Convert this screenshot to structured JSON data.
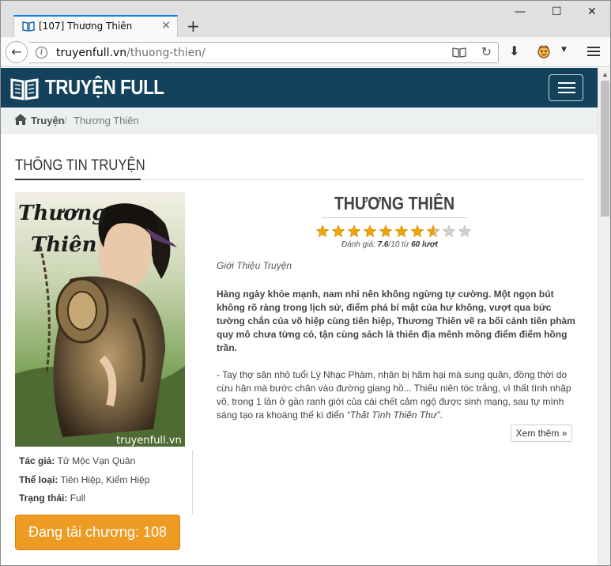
{
  "browser": {
    "tab_title": "[107] Thương Thiên",
    "tab_close": "×",
    "new_tab": "+",
    "window_controls": {
      "minimize": "—",
      "maximize": "☐",
      "close": "✕"
    },
    "url_host": "truyenfull.vn",
    "url_path": "/thuong-thien/",
    "icons": [
      "back-icon",
      "info-icon",
      "reader-view-icon",
      "reload-icon",
      "download-icon",
      "extension-icon",
      "overflow-menu-icon"
    ]
  },
  "site": {
    "logo_text": "TRUYỆN FULL",
    "brand_color": "#14425d",
    "breadcrumb": [
      "Truyện",
      "Thương Thiên"
    ],
    "breadcrumb_sep": "/"
  },
  "section_title": "Thông tin truyện",
  "cover": {
    "title_line1": "Thương",
    "title_line2": "Thiên",
    "watermark": "truyenfull.vn"
  },
  "info": {
    "author_label": "Tác giả:",
    "author": "Tử Mộc Vạn Quân",
    "genre_label": "Thể loại:",
    "genre": "Tiên Hiệp, Kiếm Hiệp",
    "status_label": "Trạng thái:",
    "status": "Full"
  },
  "loading_button": "Đang tải chương: 108",
  "story": {
    "title": "THƯƠNG THIÊN",
    "rating": 7.6,
    "rating_max": 10,
    "stars_total": 10,
    "rating_label": "Đánh giá:",
    "rating_value": "7.6",
    "rating_mid": "/10 từ ",
    "rating_count": "60 lượt",
    "intro_label": "Giới Thiệu Truyện",
    "desc_bold": "Hàng ngày khỏe mạnh, nam nhi nên không ngừng tự cường. Một ngọn bút không rõ ràng trong lịch sử, điểm phá bí mật của hư không, vượt qua bức tường chắn của võ hiệp cùng tiên hiệp, Thương Thiên vẽ ra bối cảnh tiên phàm quy mô chưa từng có, tận cùng sách là thiên địa mênh mông điểm điểm hồng trần.",
    "desc_normal": "- Tay thợ săn nhỏ tuổi Lý Nhạc Phàm, nhân bị hãm hại mà sung quân, đồng thời do cừu hận mà bước chân vào đường giang hồ... Thiếu niên tóc trắng, vì thất tình nhập võ, trong 1 lần ở gần ranh giới của cái chết cảm ngộ được sinh mạng, sau tự mình sáng tạo ra khoáng thế kì điển ",
    "desc_quote": "“Thất Tình Thiên Thư”",
    "desc_end": ".",
    "more_button": "Xem thêm »"
  },
  "colors": {
    "accent": "#ee9b24",
    "star": "#f0a30a",
    "star_empty": "#d0d0d0"
  }
}
